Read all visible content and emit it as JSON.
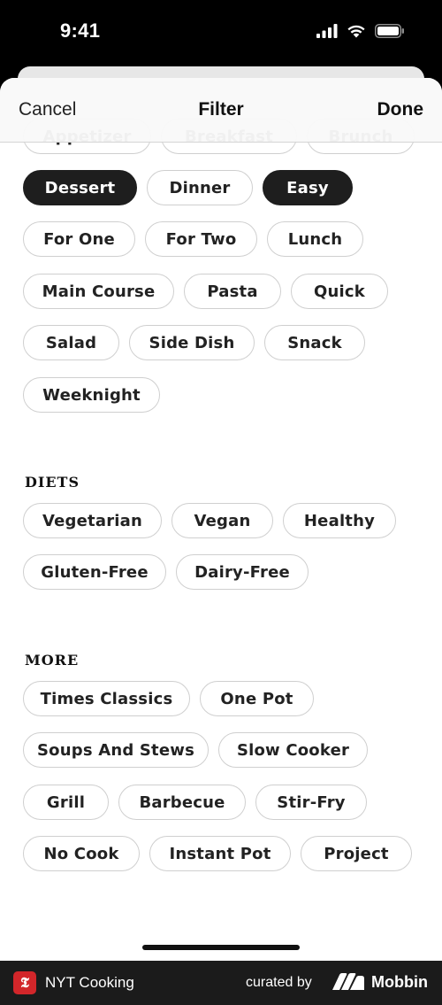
{
  "status": {
    "time": "9:41"
  },
  "nav": {
    "cancel": "Cancel",
    "title": "Filter",
    "done": "Done"
  },
  "partial_row": [
    "Appetizer",
    "Breakfast",
    "Brunch"
  ],
  "type_rows": [
    [
      {
        "label": "Dessert",
        "selected": true
      },
      {
        "label": "Dinner",
        "selected": false
      },
      {
        "label": "Easy",
        "selected": true
      }
    ],
    [
      {
        "label": "For One",
        "selected": false
      },
      {
        "label": "For Two",
        "selected": false
      },
      {
        "label": "Lunch",
        "selected": false
      }
    ],
    [
      {
        "label": "Main Course",
        "selected": false
      },
      {
        "label": "Pasta",
        "selected": false
      },
      {
        "label": "Quick",
        "selected": false
      }
    ],
    [
      {
        "label": "Salad",
        "selected": false
      },
      {
        "label": "Side Dish",
        "selected": false
      },
      {
        "label": "Snack",
        "selected": false
      }
    ],
    [
      {
        "label": "Weeknight",
        "selected": false
      }
    ]
  ],
  "diets": {
    "heading": "DIETS",
    "rows": [
      [
        {
          "label": "Vegetarian"
        },
        {
          "label": "Vegan"
        },
        {
          "label": "Healthy"
        }
      ],
      [
        {
          "label": "Gluten-Free"
        },
        {
          "label": "Dairy-Free"
        }
      ]
    ]
  },
  "more": {
    "heading": "MORE",
    "rows": [
      [
        {
          "label": "Times Classics"
        },
        {
          "label": "One Pot"
        }
      ],
      [
        {
          "label": "Soups And Stews"
        },
        {
          "label": "Slow Cooker"
        }
      ],
      [
        {
          "label": "Grill"
        },
        {
          "label": "Barbecue"
        },
        {
          "label": "Stir-Fry"
        }
      ],
      [
        {
          "label": "No Cook"
        },
        {
          "label": "Instant Pot"
        },
        {
          "label": "Project"
        }
      ]
    ]
  },
  "footer": {
    "app_name": "NYT Cooking",
    "curated_by": "curated by",
    "brand": "Mobbin",
    "logo_letter": "𝕿"
  },
  "colors": {
    "selected_chip": "#1e1e1e",
    "chip_border": "#cfcfcf",
    "footer_bg": "#1b1b1b",
    "logo_red": "#d2262a"
  }
}
